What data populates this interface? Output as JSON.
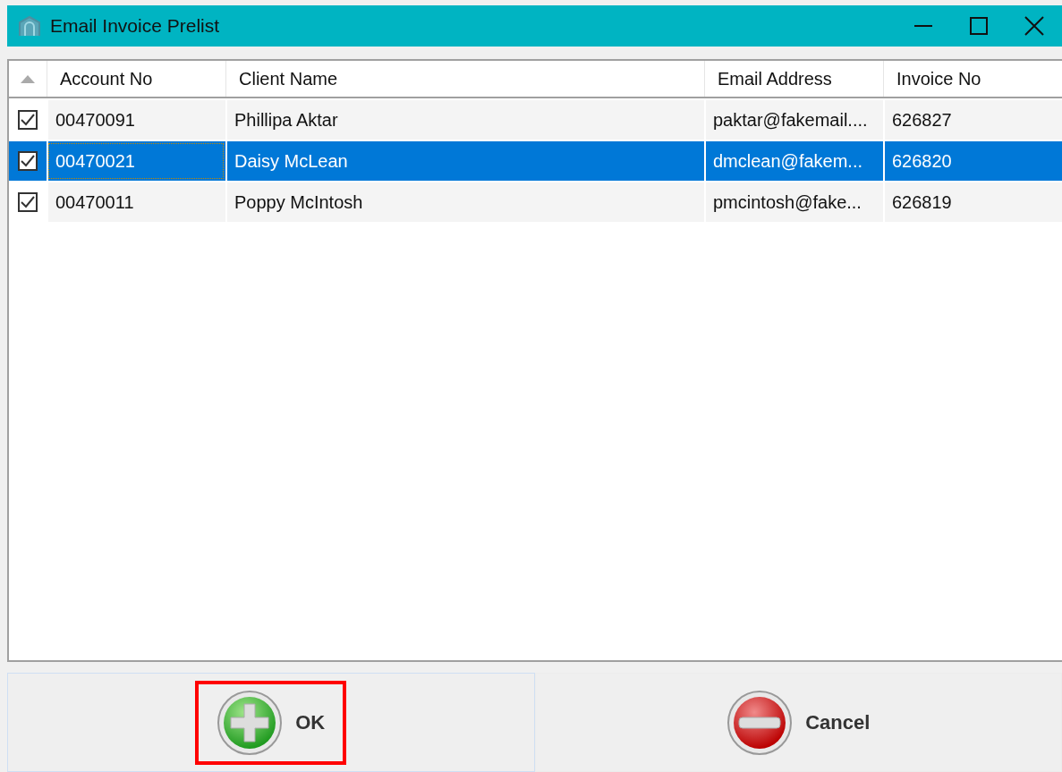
{
  "window": {
    "title": "Email Invoice Prelist"
  },
  "table": {
    "columns": [
      "Account No",
      "Client Name",
      "Email Address",
      "Invoice No"
    ],
    "rows": [
      {
        "checked": true,
        "selected": false,
        "cells": [
          "00470091",
          "Phillipa Aktar",
          "paktar@fakemail....",
          "626827"
        ]
      },
      {
        "checked": true,
        "selected": true,
        "cells": [
          "00470021",
          "Daisy McLean",
          "dmclean@fakem...",
          "626820"
        ]
      },
      {
        "checked": true,
        "selected": false,
        "cells": [
          "00470011",
          "Poppy McIntosh",
          "pmcintosh@fake...",
          "626819"
        ]
      }
    ]
  },
  "buttons": [
    {
      "kind": "ok",
      "label": "OK",
      "hovered": true,
      "highlighted": true
    },
    {
      "kind": "cancel",
      "label": "Cancel",
      "hovered": false,
      "highlighted": false
    }
  ]
}
